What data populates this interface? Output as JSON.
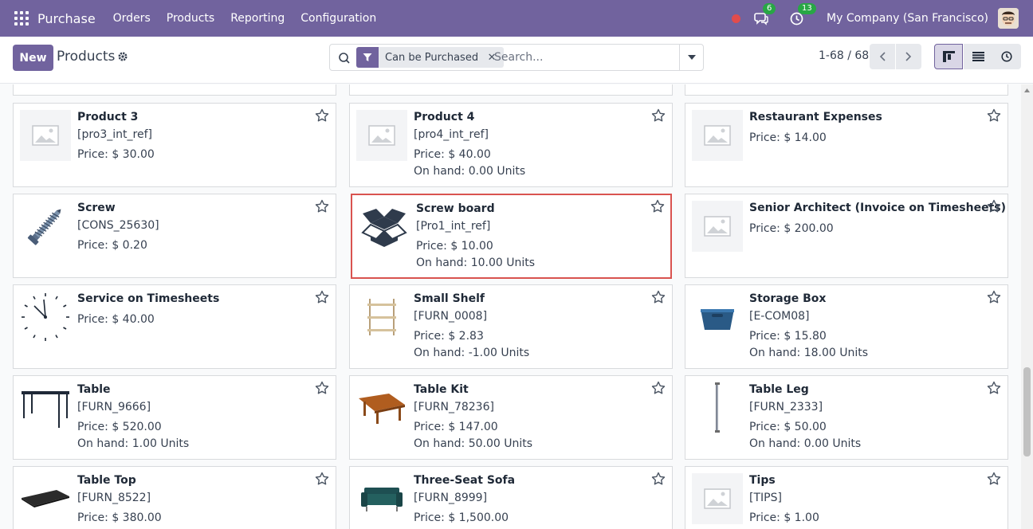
{
  "navbar": {
    "app_name": "Purchase",
    "menu": [
      "Orders",
      "Products",
      "Reporting",
      "Configuration"
    ],
    "chat_badge": "6",
    "activity_badge": "13",
    "company": "My Company (San Francisco)"
  },
  "control": {
    "new_label": "New",
    "title": "Products",
    "facet_label": "Can be Purchased",
    "search_placeholder": "Search...",
    "pager": "1-68 / 68"
  },
  "cards": [
    {
      "name": "Product 3",
      "ref": "[pro3_int_ref]",
      "price": "Price: $ 30.00",
      "onhand": "",
      "image": "placeholder"
    },
    {
      "name": "Product 4",
      "ref": "[pro4_int_ref]",
      "price": "Price: $ 40.00",
      "onhand": "On hand: 0.00 Units",
      "image": "placeholder"
    },
    {
      "name": "Restaurant Expenses",
      "ref": "",
      "price": "Price: $ 14.00",
      "onhand": "",
      "image": "placeholder"
    },
    {
      "name": "Screw",
      "ref": "[CONS_25630]",
      "price": "Price: $ 0.20",
      "onhand": "",
      "image": "screw"
    },
    {
      "name": "Screw board",
      "ref": "[Pro1_int_ref]",
      "price": "Price: $ 10.00",
      "onhand": "On hand: 10.00 Units",
      "image": "box"
    },
    {
      "name": "Senior Architect (Invoice on Timesheets)",
      "ref": "",
      "price": "Price: $ 200.00",
      "onhand": "",
      "image": "placeholder"
    },
    {
      "name": "Service on Timesheets",
      "ref": "",
      "price": "Price: $ 40.00",
      "onhand": "",
      "image": "clock"
    },
    {
      "name": "Small Shelf",
      "ref": "[FURN_0008]",
      "price": "Price: $ 2.83",
      "onhand": "On hand: -1.00 Units",
      "image": "shelf"
    },
    {
      "name": "Storage Box",
      "ref": "[E-COM08]",
      "price": "Price: $ 15.80",
      "onhand": "On hand: 18.00 Units",
      "image": "storagebox"
    },
    {
      "name": "Table",
      "ref": "[FURN_9666]",
      "price": "Price: $ 520.00",
      "onhand": "On hand: 1.00 Units",
      "image": "table"
    },
    {
      "name": "Table Kit",
      "ref": "[FURN_78236]",
      "price": "Price: $ 147.00",
      "onhand": "On hand: 50.00 Units",
      "image": "tablekit"
    },
    {
      "name": "Table Leg",
      "ref": "[FURN_2333]",
      "price": "Price: $ 50.00",
      "onhand": "On hand: 0.00 Units",
      "image": "tableleg"
    },
    {
      "name": "Table Top",
      "ref": "[FURN_8522]",
      "price": "Price: $ 380.00",
      "onhand": "",
      "image": "tabletop"
    },
    {
      "name": "Three-Seat Sofa",
      "ref": "[FURN_8999]",
      "price": "Price: $ 1,500.00",
      "onhand": "",
      "image": "sofa"
    },
    {
      "name": "Tips",
      "ref": "[TIPS]",
      "price": "Price: $ 1.00",
      "onhand": "",
      "image": "placeholder"
    }
  ],
  "selected_card": "Screw board"
}
